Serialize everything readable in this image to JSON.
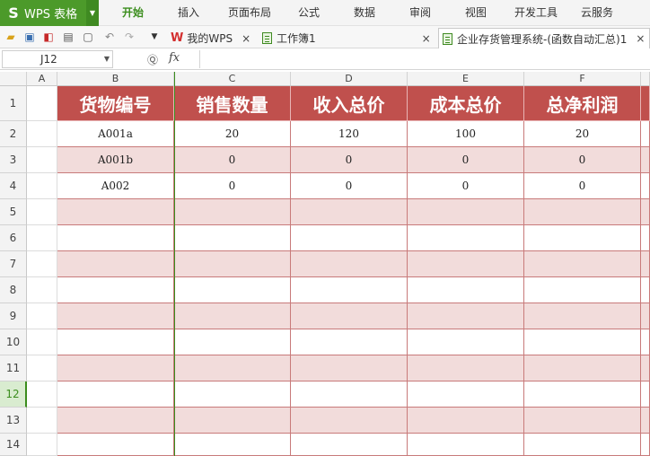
{
  "app": {
    "logo": "S",
    "title": "WPS 表格"
  },
  "menus": [
    "开始",
    "插入",
    "页面布局",
    "公式",
    "数据",
    "审阅",
    "视图",
    "开发工具",
    "云服务"
  ],
  "tabs": [
    {
      "label": "我的WPS",
      "close": "×"
    },
    {
      "label": "工作簿1",
      "close": "×"
    },
    {
      "label": "企业存货管理系统-(函数自动汇总)1",
      "close": "×"
    }
  ],
  "formula_bar": {
    "cell_ref": "J12",
    "fx_label": "fx",
    "value": ""
  },
  "columns": [
    "A",
    "B",
    "C",
    "D",
    "E",
    "F"
  ],
  "rows": [
    "1",
    "2",
    "3",
    "4",
    "5",
    "6",
    "7",
    "8",
    "9",
    "10",
    "11",
    "12",
    "13",
    "14"
  ],
  "selected_row": "12",
  "table": {
    "headers": [
      "货物编号",
      "销售数量",
      "收入总价",
      "成本总价",
      "总净利润"
    ],
    "data": [
      [
        "A001a",
        "20",
        "120",
        "100",
        "20"
      ],
      [
        "A001b",
        "0",
        "0",
        "0",
        "0"
      ],
      [
        "A002",
        "0",
        "0",
        "0",
        "0"
      ]
    ]
  },
  "colors": {
    "header_fill": "#c0504d",
    "band_fill": "#f2dcdb",
    "accent": "#4c9a2a"
  }
}
